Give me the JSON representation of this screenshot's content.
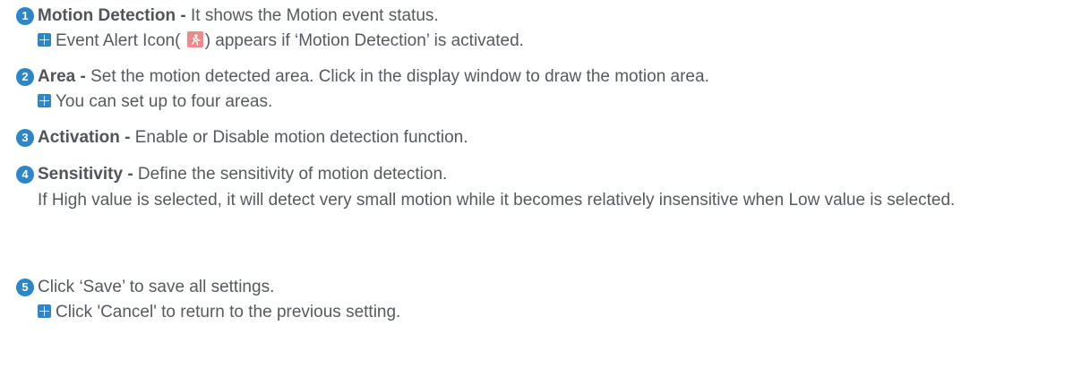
{
  "colors": {
    "number_badge": "#2d86c8",
    "note_icon": "#2d86c8",
    "alert_icon": "#f08a8a",
    "text": "#555a60"
  },
  "items": [
    {
      "number": "1",
      "term": "Motion Detection -",
      "text": " It shows the Motion event status.",
      "note_before": "Event Alert Icon(",
      "note_after": ") appears if ‘Motion Detection’ is activated."
    },
    {
      "number": "2",
      "term": "Area -",
      "text": " Set the motion detected area. Click in the display window to draw the motion area.",
      "note": "You can set up to four areas."
    },
    {
      "number": "3",
      "term": "Activation -",
      "text": " Enable or Disable motion detection function."
    },
    {
      "number": "4",
      "term": "Sensitivity -",
      "text": " Define the sensitivity of motion detection.",
      "continuation": "If High value is selected, it will detect very small motion while it becomes relatively insensitive when Low value is selected."
    },
    {
      "number": "5",
      "text": "Click ‘Save’ to save all settings.",
      "note": "Click 'Cancel' to return to the previous setting."
    }
  ]
}
